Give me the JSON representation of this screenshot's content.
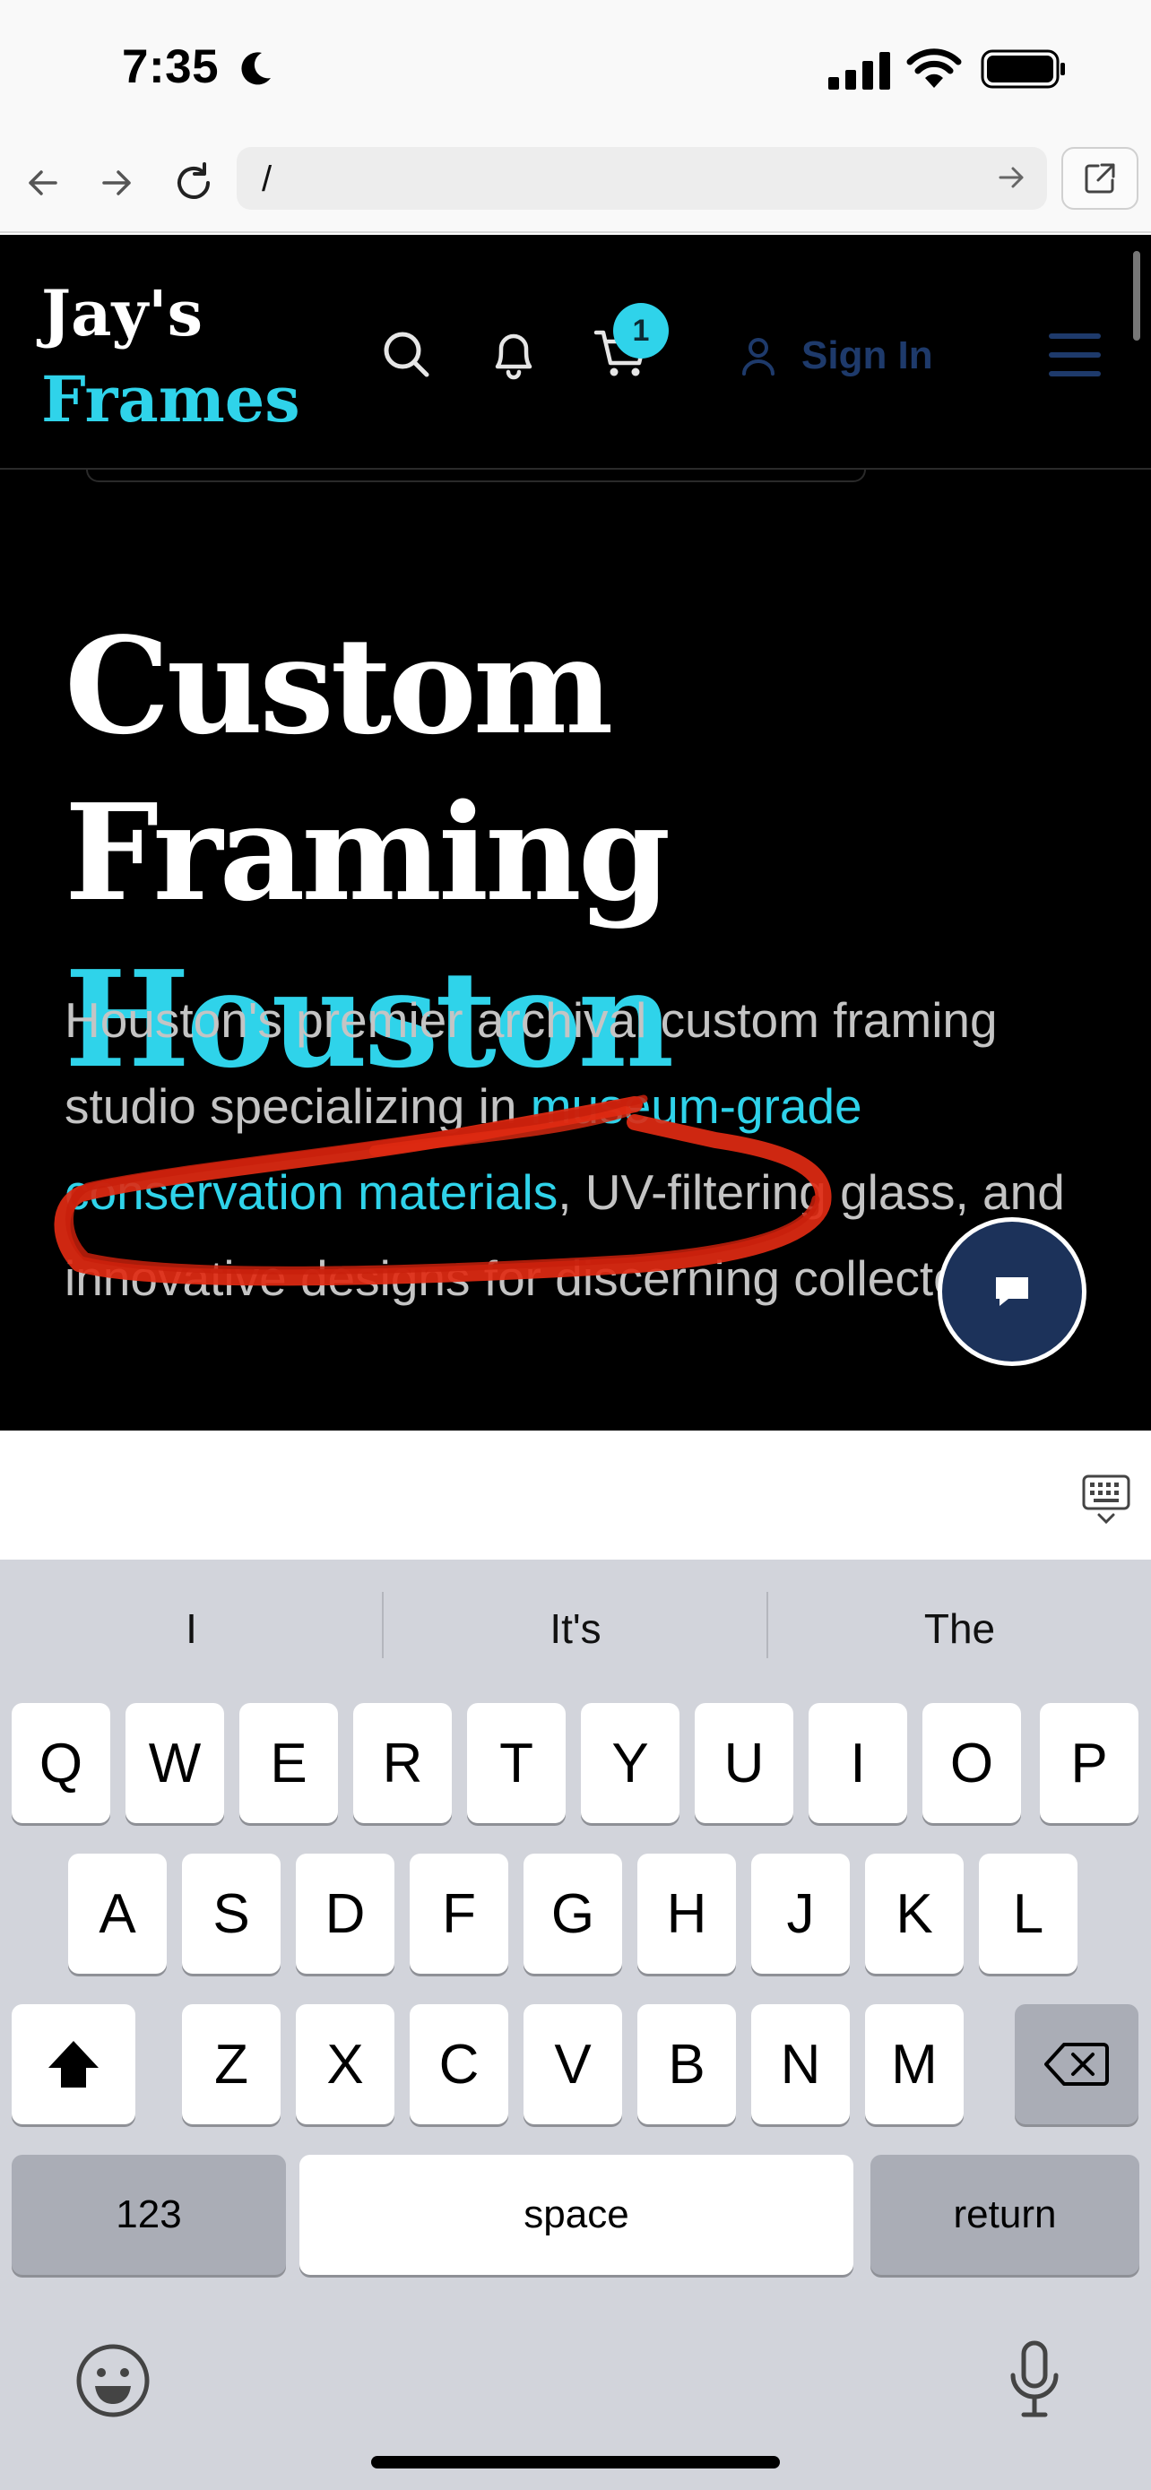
{
  "status_bar": {
    "time": "7:35",
    "icons": [
      "moon-icon",
      "signal-icon",
      "wifi-icon",
      "battery-icon"
    ]
  },
  "browser": {
    "url": "/",
    "icons": [
      "back-arrow-icon",
      "forward-arrow-icon",
      "reload-icon",
      "go-arrow-icon",
      "open-external-icon"
    ]
  },
  "site_header": {
    "logo_line1": "Jay's",
    "logo_line2": "Frames",
    "cart_count": "1",
    "sign_in_label": "Sign In",
    "icons": [
      "search-icon",
      "bell-icon",
      "cart-icon",
      "user-icon",
      "menu-icon"
    ]
  },
  "hero": {
    "title_line1": "Custom Framing",
    "title_line2": "Houston",
    "desc_before": "Houston's premier archival custom framing studio specializing in ",
    "desc_highlight": "museum-grade conservation materials",
    "desc_after": ", UV-filtering glass, and innovative designs for discerning collectors."
  },
  "chat": {
    "icon": "chat-bubble-icon"
  },
  "keyboard": {
    "suggestions": [
      "I",
      "It's",
      "The"
    ],
    "row1": [
      "Q",
      "W",
      "E",
      "R",
      "T",
      "Y",
      "U",
      "I",
      "O",
      "P"
    ],
    "row2": [
      "A",
      "S",
      "D",
      "F",
      "G",
      "H",
      "J",
      "K",
      "L"
    ],
    "row3": [
      "Z",
      "X",
      "C",
      "V",
      "B",
      "N",
      "M"
    ],
    "numbers_label": "123",
    "space_label": "space",
    "return_label": "return",
    "icons": [
      "shift-icon",
      "backspace-icon",
      "emoji-icon",
      "microphone-icon",
      "keyboard-dismiss-icon"
    ]
  },
  "colors": {
    "accent": "#2fd3ea",
    "brand_navy": "#1c325a",
    "annotation_red": "#e02a12",
    "keyboard_bg": "#d2d4db"
  }
}
